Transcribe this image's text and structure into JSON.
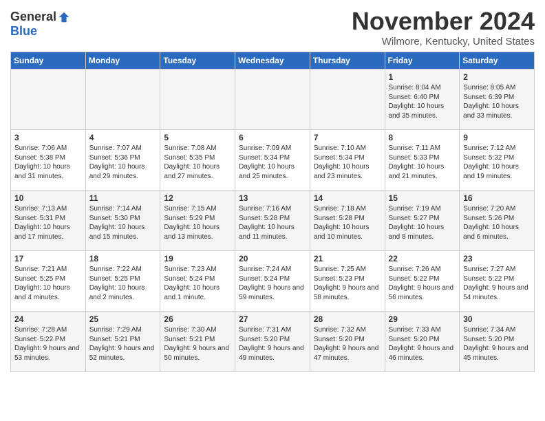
{
  "header": {
    "logo_general": "General",
    "logo_blue": "Blue",
    "title": "November 2024",
    "location": "Wilmore, Kentucky, United States"
  },
  "weekdays": [
    "Sunday",
    "Monday",
    "Tuesday",
    "Wednesday",
    "Thursday",
    "Friday",
    "Saturday"
  ],
  "weeks": [
    [
      {
        "day": "",
        "info": ""
      },
      {
        "day": "",
        "info": ""
      },
      {
        "day": "",
        "info": ""
      },
      {
        "day": "",
        "info": ""
      },
      {
        "day": "",
        "info": ""
      },
      {
        "day": "1",
        "info": "Sunrise: 8:04 AM\nSunset: 6:40 PM\nDaylight: 10 hours\nand 35 minutes."
      },
      {
        "day": "2",
        "info": "Sunrise: 8:05 AM\nSunset: 6:39 PM\nDaylight: 10 hours\nand 33 minutes."
      }
    ],
    [
      {
        "day": "3",
        "info": "Sunrise: 7:06 AM\nSunset: 5:38 PM\nDaylight: 10 hours\nand 31 minutes."
      },
      {
        "day": "4",
        "info": "Sunrise: 7:07 AM\nSunset: 5:36 PM\nDaylight: 10 hours\nand 29 minutes."
      },
      {
        "day": "5",
        "info": "Sunrise: 7:08 AM\nSunset: 5:35 PM\nDaylight: 10 hours\nand 27 minutes."
      },
      {
        "day": "6",
        "info": "Sunrise: 7:09 AM\nSunset: 5:34 PM\nDaylight: 10 hours\nand 25 minutes."
      },
      {
        "day": "7",
        "info": "Sunrise: 7:10 AM\nSunset: 5:34 PM\nDaylight: 10 hours\nand 23 minutes."
      },
      {
        "day": "8",
        "info": "Sunrise: 7:11 AM\nSunset: 5:33 PM\nDaylight: 10 hours\nand 21 minutes."
      },
      {
        "day": "9",
        "info": "Sunrise: 7:12 AM\nSunset: 5:32 PM\nDaylight: 10 hours\nand 19 minutes."
      }
    ],
    [
      {
        "day": "10",
        "info": "Sunrise: 7:13 AM\nSunset: 5:31 PM\nDaylight: 10 hours\nand 17 minutes."
      },
      {
        "day": "11",
        "info": "Sunrise: 7:14 AM\nSunset: 5:30 PM\nDaylight: 10 hours\nand 15 minutes."
      },
      {
        "day": "12",
        "info": "Sunrise: 7:15 AM\nSunset: 5:29 PM\nDaylight: 10 hours\nand 13 minutes."
      },
      {
        "day": "13",
        "info": "Sunrise: 7:16 AM\nSunset: 5:28 PM\nDaylight: 10 hours\nand 11 minutes."
      },
      {
        "day": "14",
        "info": "Sunrise: 7:18 AM\nSunset: 5:28 PM\nDaylight: 10 hours\nand 10 minutes."
      },
      {
        "day": "15",
        "info": "Sunrise: 7:19 AM\nSunset: 5:27 PM\nDaylight: 10 hours\nand 8 minutes."
      },
      {
        "day": "16",
        "info": "Sunrise: 7:20 AM\nSunset: 5:26 PM\nDaylight: 10 hours\nand 6 minutes."
      }
    ],
    [
      {
        "day": "17",
        "info": "Sunrise: 7:21 AM\nSunset: 5:25 PM\nDaylight: 10 hours\nand 4 minutes."
      },
      {
        "day": "18",
        "info": "Sunrise: 7:22 AM\nSunset: 5:25 PM\nDaylight: 10 hours\nand 2 minutes."
      },
      {
        "day": "19",
        "info": "Sunrise: 7:23 AM\nSunset: 5:24 PM\nDaylight: 10 hours\nand 1 minute."
      },
      {
        "day": "20",
        "info": "Sunrise: 7:24 AM\nSunset: 5:24 PM\nDaylight: 9 hours\nand 59 minutes."
      },
      {
        "day": "21",
        "info": "Sunrise: 7:25 AM\nSunset: 5:23 PM\nDaylight: 9 hours\nand 58 minutes."
      },
      {
        "day": "22",
        "info": "Sunrise: 7:26 AM\nSunset: 5:22 PM\nDaylight: 9 hours\nand 56 minutes."
      },
      {
        "day": "23",
        "info": "Sunrise: 7:27 AM\nSunset: 5:22 PM\nDaylight: 9 hours\nand 54 minutes."
      }
    ],
    [
      {
        "day": "24",
        "info": "Sunrise: 7:28 AM\nSunset: 5:22 PM\nDaylight: 9 hours\nand 53 minutes."
      },
      {
        "day": "25",
        "info": "Sunrise: 7:29 AM\nSunset: 5:21 PM\nDaylight: 9 hours\nand 52 minutes."
      },
      {
        "day": "26",
        "info": "Sunrise: 7:30 AM\nSunset: 5:21 PM\nDaylight: 9 hours\nand 50 minutes."
      },
      {
        "day": "27",
        "info": "Sunrise: 7:31 AM\nSunset: 5:20 PM\nDaylight: 9 hours\nand 49 minutes."
      },
      {
        "day": "28",
        "info": "Sunrise: 7:32 AM\nSunset: 5:20 PM\nDaylight: 9 hours\nand 47 minutes."
      },
      {
        "day": "29",
        "info": "Sunrise: 7:33 AM\nSunset: 5:20 PM\nDaylight: 9 hours\nand 46 minutes."
      },
      {
        "day": "30",
        "info": "Sunrise: 7:34 AM\nSunset: 5:20 PM\nDaylight: 9 hours\nand 45 minutes."
      }
    ]
  ]
}
